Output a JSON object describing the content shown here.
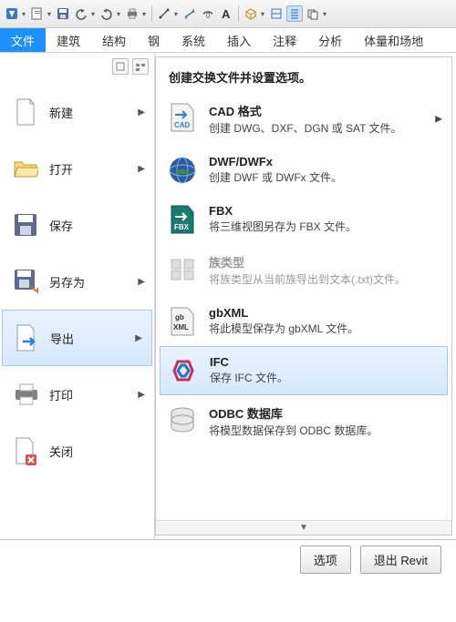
{
  "qat_items": [
    "revit",
    "doc",
    "save",
    "undo",
    "redo",
    "print",
    "measure",
    "angle",
    "dimension",
    "text-a",
    "3dbox",
    "section",
    "thinview",
    "props",
    "switch"
  ],
  "tabs": [
    "文件",
    "建筑",
    "结构",
    "钢",
    "系统",
    "插入",
    "注释",
    "分析",
    "体量和场地"
  ],
  "active_tab_index": 0,
  "menu": [
    {
      "id": "new",
      "label": "新建",
      "arrow": true,
      "icon": "new"
    },
    {
      "id": "open",
      "label": "打开",
      "arrow": true,
      "icon": "open"
    },
    {
      "id": "save",
      "label": "保存",
      "arrow": false,
      "icon": "save"
    },
    {
      "id": "saveas",
      "label": "另存为",
      "arrow": true,
      "icon": "saveas"
    },
    {
      "id": "export",
      "label": "导出",
      "arrow": true,
      "icon": "export",
      "selected": true
    },
    {
      "id": "print",
      "label": "打印",
      "arrow": true,
      "icon": "print"
    },
    {
      "id": "close",
      "label": "关闭",
      "arrow": false,
      "icon": "close"
    }
  ],
  "panel_header": "创建交换文件并设置选项。",
  "export_items": [
    {
      "id": "cad",
      "title": "CAD 格式",
      "desc": "创建 DWG、DXF、DGN 或 SAT 文件。",
      "arrow": true
    },
    {
      "id": "dwf",
      "title": "DWF/DWFx",
      "desc": "创建 DWF 或 DWFx 文件。"
    },
    {
      "id": "fbx",
      "title": "FBX",
      "desc": "将三维视图另存为 FBX 文件。"
    },
    {
      "id": "family",
      "title": "族类型",
      "desc": "将族类型从当前族导出到文本(.txt)文件。",
      "disabled": true
    },
    {
      "id": "gbxml",
      "title": "gbXML",
      "desc": "将此模型保存为 gbXML 文件。"
    },
    {
      "id": "ifc",
      "title": "IFC",
      "desc": "保存 IFC 文件。",
      "selected": true
    },
    {
      "id": "odbc",
      "title": "ODBC 数据库",
      "desc": "将模型数据保存到 ODBC 数据库。"
    }
  ],
  "footer": {
    "options": "选项",
    "exit": "退出 Revit"
  }
}
